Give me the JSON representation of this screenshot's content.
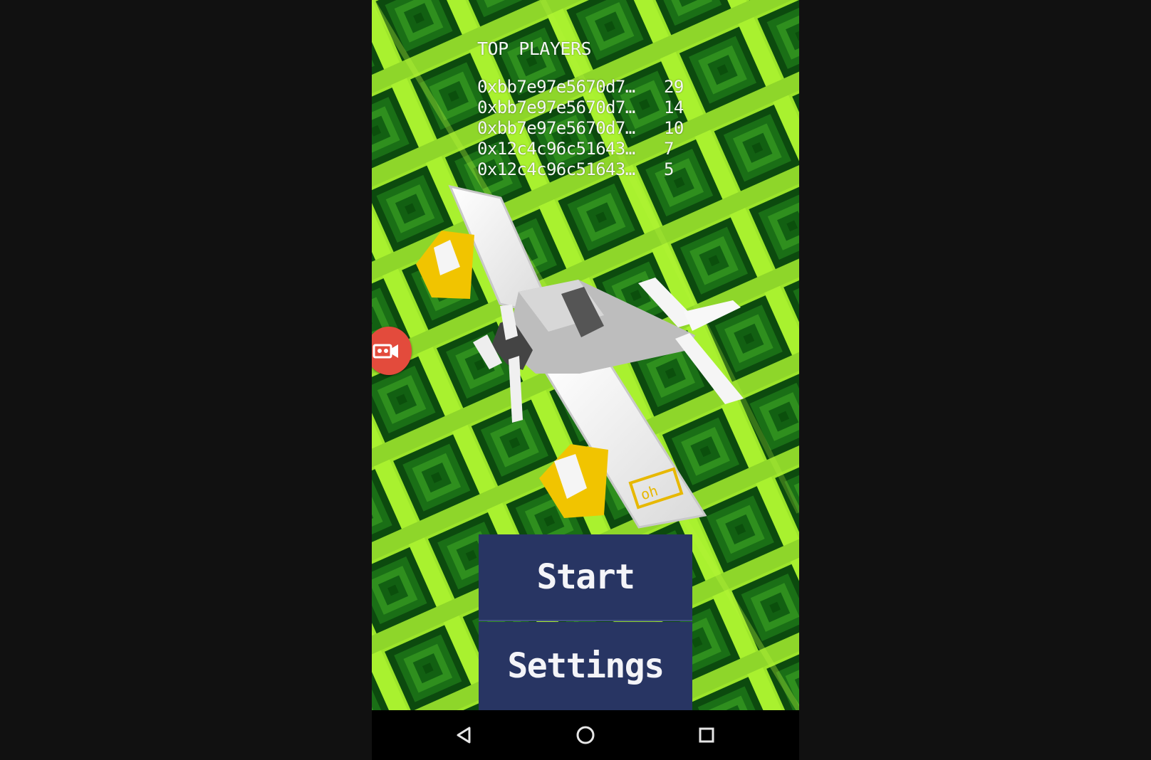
{
  "leaderboard": {
    "title": "TOP PLAYERS",
    "entries": [
      {
        "player": "0xbb7e97e5670d7…",
        "score": "29"
      },
      {
        "player": "0xbb7e97e5670d7…",
        "score": "14"
      },
      {
        "player": "0xbb7e97e5670d7…",
        "score": "10"
      },
      {
        "player": "0x12c4c96c51643…",
        "score": "7"
      },
      {
        "player": "0x12c4c96c51643…",
        "score": "5"
      }
    ]
  },
  "menu": {
    "start_label": "Start",
    "settings_label": "Settings"
  },
  "icons": {
    "record": "video-camera-icon",
    "back": "back-icon",
    "home": "home-icon",
    "recents": "recents-icon"
  },
  "colors": {
    "background": "#111111",
    "grass": "#a6ef2e",
    "trees": "#1f6f16",
    "button": "#283563",
    "record": "#e34b3c"
  }
}
